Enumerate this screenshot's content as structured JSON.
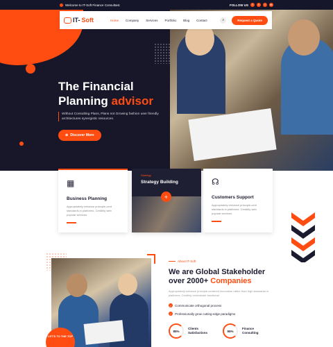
{
  "topbar": {
    "welcome": "Welcome to IT-Soft Finance Consultant.",
    "follow": "FOLLOW US",
    "social_icons": [
      "facebook-icon",
      "twitter-icon",
      "instagram-icon",
      "linkedin-icon"
    ]
  },
  "header": {
    "logo_prefix": "IT-",
    "logo_suffix": "Soft",
    "nav": [
      {
        "label": "Home",
        "active": true
      },
      {
        "label": "Company"
      },
      {
        "label": "Services"
      },
      {
        "label": "Portfolio"
      },
      {
        "label": "Blog"
      },
      {
        "label": "Contact"
      }
    ],
    "cta": "Request a Quote"
  },
  "hero": {
    "title_line1": "The Financial",
    "title_line2": "Planning",
    "title_accent": "advisor",
    "subtitle": "Without Consulting Plans, Plans not Growing fashion user friendly architectures synergistic resources.",
    "button": "Discover More"
  },
  "cards": {
    "c1": {
      "title": "Business Planning",
      "text": "Appropriately enhance principle-cent standards in platforms. Credibly web popular services."
    },
    "c2": {
      "tag": "Strategy",
      "title": "Strategy Building",
      "plus": "+"
    },
    "c3": {
      "title": "Customers Support",
      "text": "Appropriately enhance principle-cent standards in platforms. Credibly web popular services."
    }
  },
  "about": {
    "badge": "LET'S TO THE TOP",
    "tag": "About IT-Soft",
    "title_line1": "We are Global Stakeholder",
    "title_line2": "over 2000+",
    "title_accent": "Companies",
    "desc": "Appropriately enhance principle-centered innovation rather than high standards in platforms. Credibly orchestrate functional",
    "checks": [
      "Communicate orthogonal process",
      "Professionally grow cutting-edge paradigms"
    ],
    "stats": [
      {
        "value": "85%",
        "label_line1": "Clients",
        "label_line2": "Satisfactions"
      },
      {
        "value": "95%",
        "label_line1": "Finance",
        "label_line2": "Consulting"
      }
    ]
  },
  "colors": {
    "accent": "#ff4d12",
    "dark": "#171729"
  }
}
